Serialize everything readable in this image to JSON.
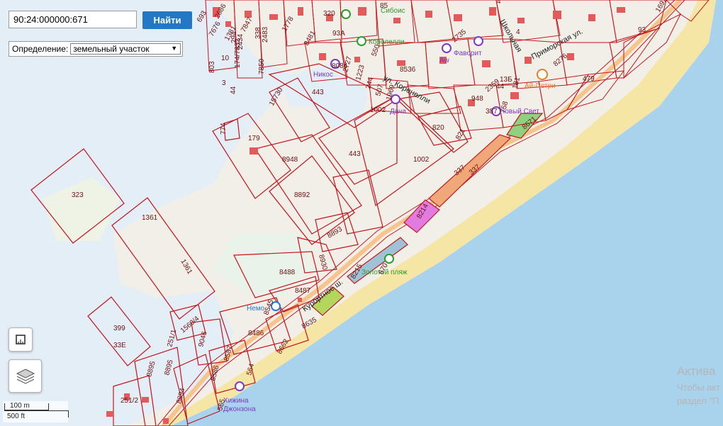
{
  "search": {
    "value": "90:24:000000:671",
    "button_label": "Найти"
  },
  "definition": {
    "label": "Определение:",
    "selected": "земельный участок"
  },
  "scale": {
    "metric": "100 m",
    "imperial": "500 ft"
  },
  "watermark": {
    "line1": "Актива",
    "line2": "Чтобы акт",
    "line3": "раздел \"П"
  },
  "parcels": [
    "323",
    "1361",
    "1361",
    "399",
    "179",
    "774",
    "15730",
    "443",
    "8948",
    "8892",
    "443",
    "1002",
    "1002",
    "820",
    "821",
    "337",
    "8893",
    "8930",
    "8488",
    "8487",
    "8545",
    "8486",
    "8635",
    "8662",
    "8587",
    "8586",
    "564",
    "565",
    "8894",
    "8895",
    "8895",
    "9046",
    "251/1",
    "1560/4",
    "251/2",
    "33Е",
    "320",
    "85",
    "8481",
    "8084",
    "2727",
    "1223",
    "244",
    "507",
    "1969",
    "8536",
    "550",
    "2735",
    "2359",
    "948",
    "387",
    "758",
    "181",
    "8276",
    "479",
    "93",
    "1692",
    "93А",
    "8214",
    "8215",
    "670",
    "337",
    "294",
    "2434",
    "174/7832",
    "338",
    "2483",
    "7850",
    "7676",
    "1381",
    "693",
    "2686",
    "7847",
    "1778",
    "803",
    "44",
    "10",
    "13Б",
    "44",
    "4",
    "4",
    "3",
    "8671"
  ],
  "pois": {
    "korolelli": "Королелли",
    "sibois": "Сибоис",
    "favorit": "Фаворит",
    "nikos": "Никос",
    "dacha": "Дача",
    "ai_petri": "Ай-Петри",
    "novy_svet": "Новый Свет",
    "zolotoy_plyazh": "Золотой пляж",
    "nemo": "Немо",
    "khizhina": "Хижина",
    "dzhonzona": "Джонзона",
    "aw": "Aw"
  },
  "streets": {
    "koreneli": "ул. Коренелли",
    "kurortnoe": "Курортное ш.",
    "primorskaya": "Приморская ул.",
    "shkolnaya": "Школьная",
    "kurortnoe_sh": "Курортное ш."
  },
  "colors": {
    "sea": "#a9d3ed",
    "parcel_stroke": "#c4161c",
    "beach": "#f6e6a6",
    "button": "#2378c6"
  }
}
